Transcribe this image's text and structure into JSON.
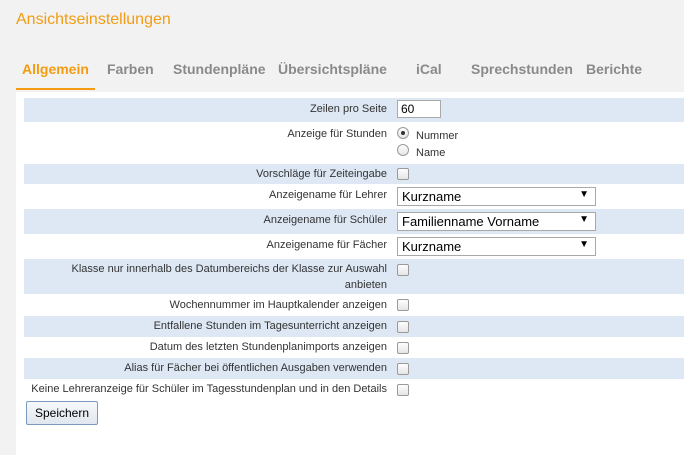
{
  "header": {
    "title": "Ansichtseinstellungen"
  },
  "tabs": [
    {
      "label": "Allgemein",
      "active": true
    },
    {
      "label": "Farben"
    },
    {
      "label": "Stundenpläne"
    },
    {
      "label": "Übersichtspläne"
    },
    {
      "label": "iCal"
    },
    {
      "label": "Sprechstunden"
    },
    {
      "label": "Berichte"
    }
  ],
  "settings": {
    "rows_per_page": {
      "label": "Zeilen pro Seite",
      "value": "60"
    },
    "display_hours": {
      "label": "Anzeige für Stunden",
      "options": [
        "Nummer",
        "Name"
      ],
      "selected": "Nummer"
    },
    "time_suggestions": {
      "label": "Vorschläge für Zeiteingabe",
      "checked": false
    },
    "teacher_name": {
      "label": "Anzeigename für Lehrer",
      "value": "Kurzname"
    },
    "student_name": {
      "label": "Anzeigename für Schüler",
      "value": "Familienname Vorname"
    },
    "subject_name": {
      "label": "Anzeigename für Fächer",
      "value": "Kurzname"
    },
    "class_date_range": {
      "label_line1": "Klasse nur innerhalb des Datumbereichs der Klasse zur Auswahl",
      "label_line2": "anbieten",
      "checked": false
    },
    "week_number": {
      "label": "Wochennummer im Hauptkalender anzeigen",
      "checked": false
    },
    "cancelled_lessons": {
      "label": "Entfallene Stunden im Tagesunterricht anzeigen",
      "checked": false
    },
    "last_import_date": {
      "label": "Datum des letzten Stundenplanimports anzeigen",
      "checked": false
    },
    "subject_alias": {
      "label": "Alias für Fächer bei öffentlichen Ausgaben verwenden",
      "checked": false
    },
    "no_teacher_display": {
      "label": "Keine Lehreranzeige für Schüler im Tagesstundenplan und in den Details",
      "checked": false
    }
  },
  "actions": {
    "save_label": "Speichern"
  },
  "colors": {
    "accent": "#f39c12",
    "row_alt": "#dde8f4",
    "tab_inactive": "#8a8a8a"
  },
  "icons": {
    "dropdown": "triangle-down-icon"
  }
}
